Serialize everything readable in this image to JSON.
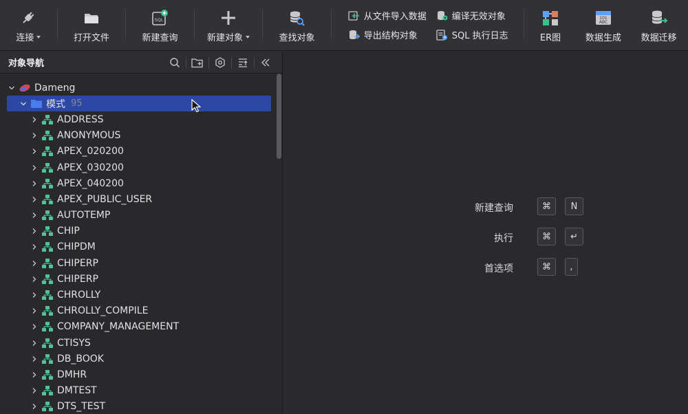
{
  "toolbar": {
    "connect": "连接",
    "open_file": "打开文件",
    "new_query": "新建查询",
    "new_object": "新建对象",
    "find_object": "查找对象",
    "import_data": "从文件导入数据",
    "export_struct": "导出结构对象",
    "compile_invalid": "编译无效对象",
    "sql_log": "SQL 执行日志",
    "er_diagram": "ER图",
    "data_gen": "数据生成",
    "data_migrate": "数据迁移"
  },
  "nav": {
    "title": "对象导航",
    "root": "Dameng",
    "schema_folder": "模式",
    "schema_count": "95",
    "schemas": [
      "ADDRESS",
      "ANONYMOUS",
      "APEX_020200",
      "APEX_030200",
      "APEX_040200",
      "APEX_PUBLIC_USER",
      "AUTOTEMP",
      "CHIP",
      "CHIPDM",
      "CHIPERP",
      "CHIPERP",
      "CHROLLY",
      "CHROLLY_COMPILE",
      "COMPANY_MANAGEMENT",
      "CTISYS",
      "DB_BOOK",
      "DMHR",
      "DMTEST",
      "DTS_TEST"
    ]
  },
  "shortcuts": [
    {
      "label": "新建查询",
      "key1": "⌘",
      "key2": "N"
    },
    {
      "label": "执行",
      "key1": "⌘",
      "key2": "↵"
    },
    {
      "label": "首选项",
      "key1": "⌘",
      "key2": ","
    }
  ],
  "colors": {
    "accent_selection": "#2c48a2",
    "schema_icon": "#4fc39a",
    "folder_icon": "#4a7cf0"
  }
}
